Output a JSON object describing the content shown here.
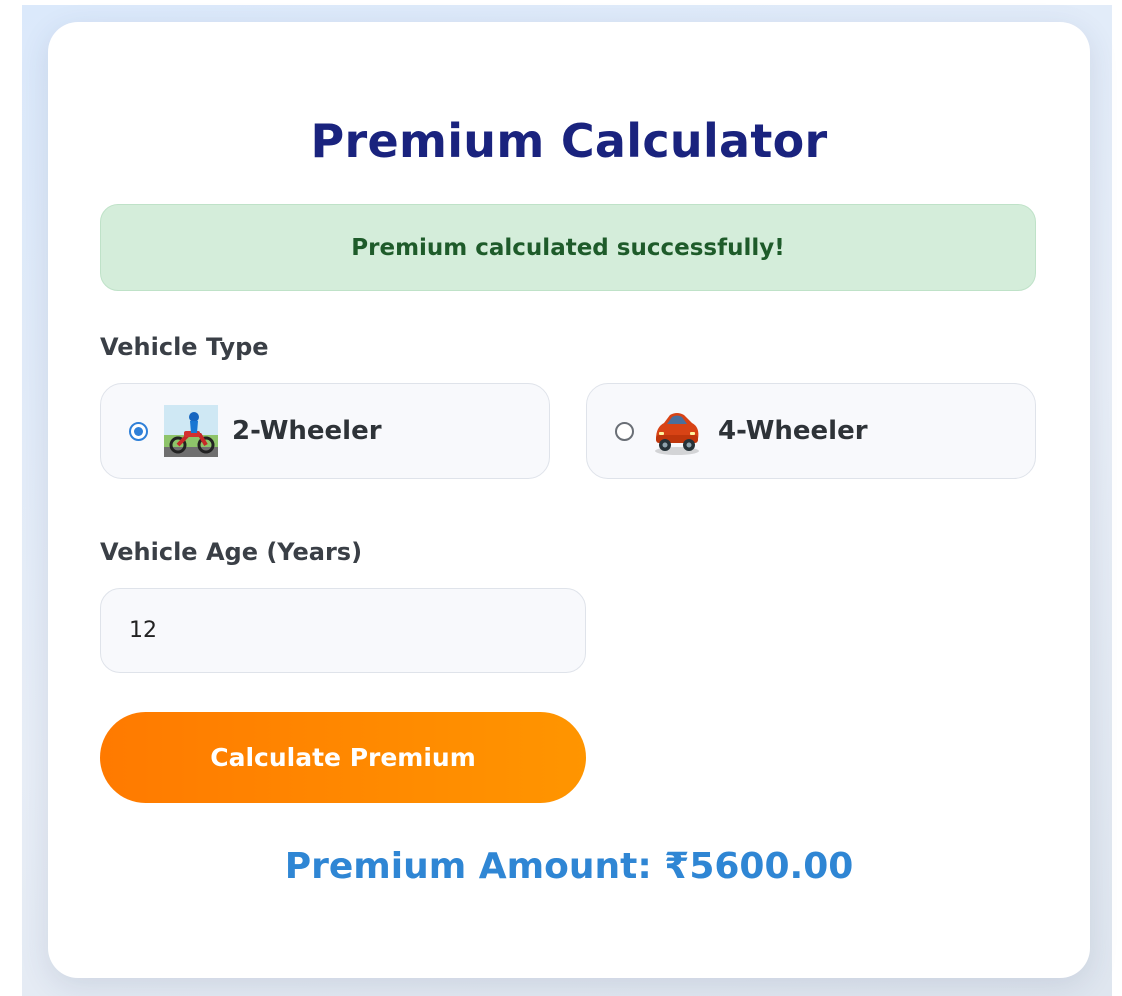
{
  "page": {
    "title": "Premium Calculator",
    "alert": "Premium calculated successfully!",
    "vehicle_type_label": "Vehicle Type",
    "options": [
      {
        "label": "2-Wheeler",
        "icon": "motorcycle-icon",
        "selected": true
      },
      {
        "label": "4-Wheeler",
        "icon": "car-icon",
        "selected": false
      }
    ],
    "vehicle_age_label": "Vehicle Age (Years)",
    "vehicle_age_value": "12",
    "button_label": "Calculate Premium",
    "result": "Premium Amount: ₹5600.00"
  },
  "colors": {
    "title": "#1a237e",
    "alert_bg": "#d4edda",
    "alert_text": "#1e5b2a",
    "accent": "#ff8800",
    "result": "#2f86d4",
    "radio_selected": "#2f80d8"
  }
}
